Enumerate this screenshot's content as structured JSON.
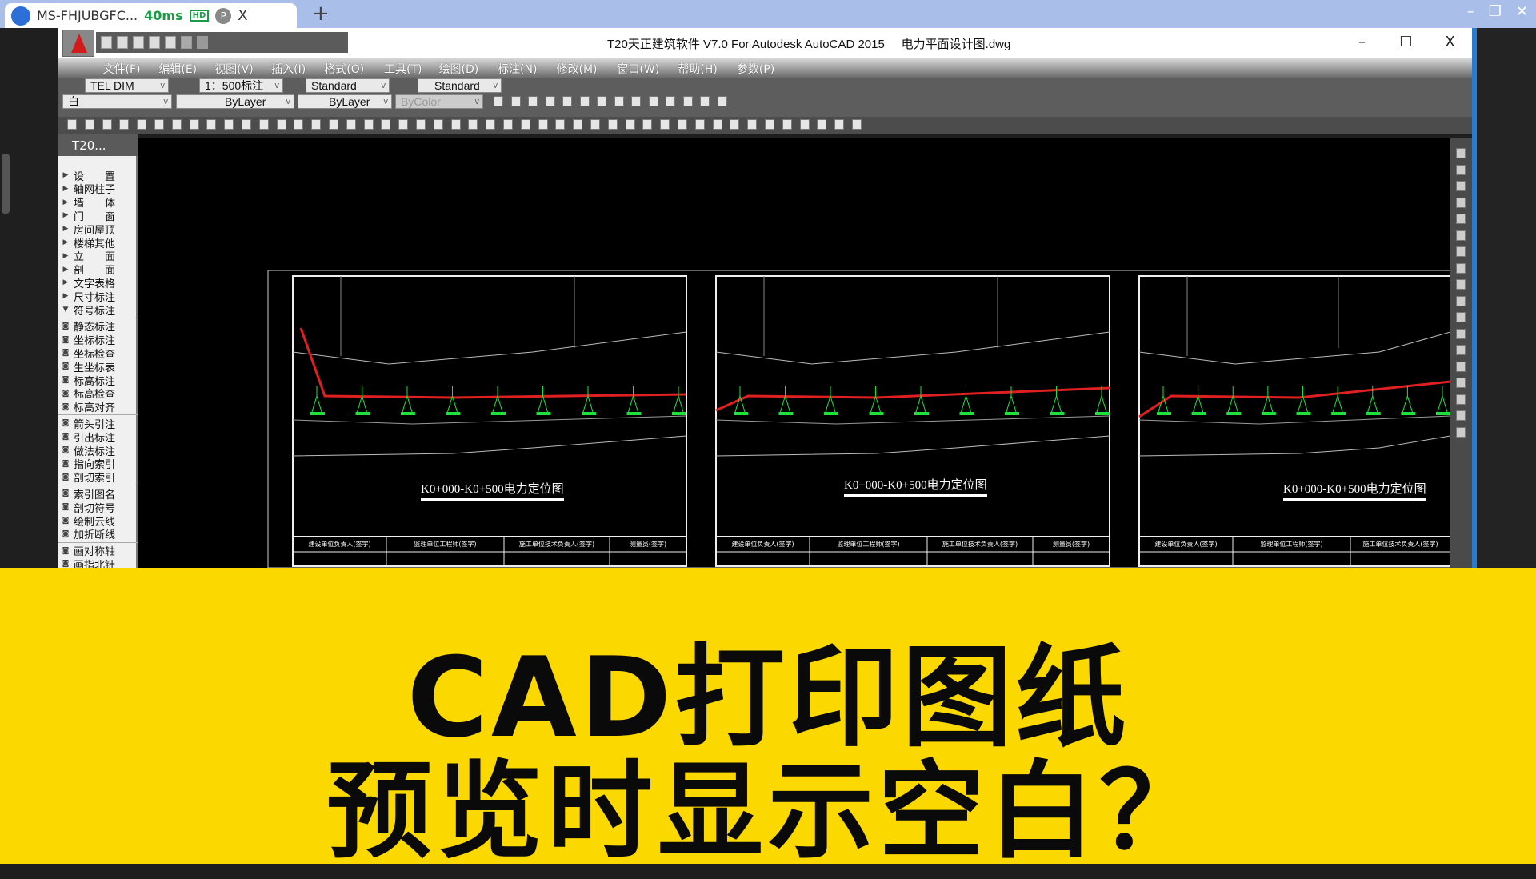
{
  "browser": {
    "tab_title": "MS-FHJUBGFC...",
    "latency": "40ms",
    "hd_badge": "HD",
    "profile_initial": "P",
    "close": "X",
    "new_tab": "+"
  },
  "window": {
    "title": "T20天正建筑软件 V7.0 For Autodesk AutoCAD 2015     电力平面设计图.dwg",
    "minimize": "–",
    "maximize": "☐",
    "close": "X"
  },
  "menu": [
    "文件(F)",
    "编辑(E)",
    "视图(V)",
    "插入(I)",
    "格式(O)",
    "工具(T)",
    "绘图(D)",
    "标注(N)",
    "修改(M)",
    "窗口(W)",
    "帮助(H)",
    "参数(P)"
  ],
  "toolbar": {
    "dim_style": "TEL DIM",
    "scale": "1：500标注",
    "text_style": "Standard",
    "table_style": "Standard",
    "layer": "白",
    "linetype": "ByLayer",
    "lineweight": "ByLayer",
    "plotstyle": "ByColor"
  },
  "sidebar": {
    "title": "T20...",
    "groups": [
      [
        "设　　置",
        "轴网柱子",
        "墙　　体",
        "门　　窗",
        "房间屋顶",
        "楼梯其他",
        "立　　面",
        "剖　　面",
        "文字表格",
        "尺寸标注",
        "符号标注"
      ],
      [
        "静态标注",
        "坐标标注",
        "坐标检查",
        "生坐标表",
        "标高标注",
        "标高检查",
        "标高对齐"
      ],
      [
        "箭头引注",
        "引出标注",
        "做法标注",
        "指向索引",
        "剖切索引"
      ],
      [
        "索引图名",
        "剖切符号",
        "绘制云线",
        "加折断线"
      ],
      [
        "画对称轴",
        "画指北针"
      ]
    ]
  },
  "drawing": {
    "sheet_title": "K0+000-K0+500电力定位图",
    "sign_headers": [
      "建设单位负责人(签字)",
      "监理单位工程师(签字)",
      "施工单位技术负责人(签字)",
      "测量员(签字)"
    ]
  },
  "banner": {
    "line1": "CAD打印图纸",
    "line2": "预览时显示空白？",
    "background": "#fad800"
  }
}
